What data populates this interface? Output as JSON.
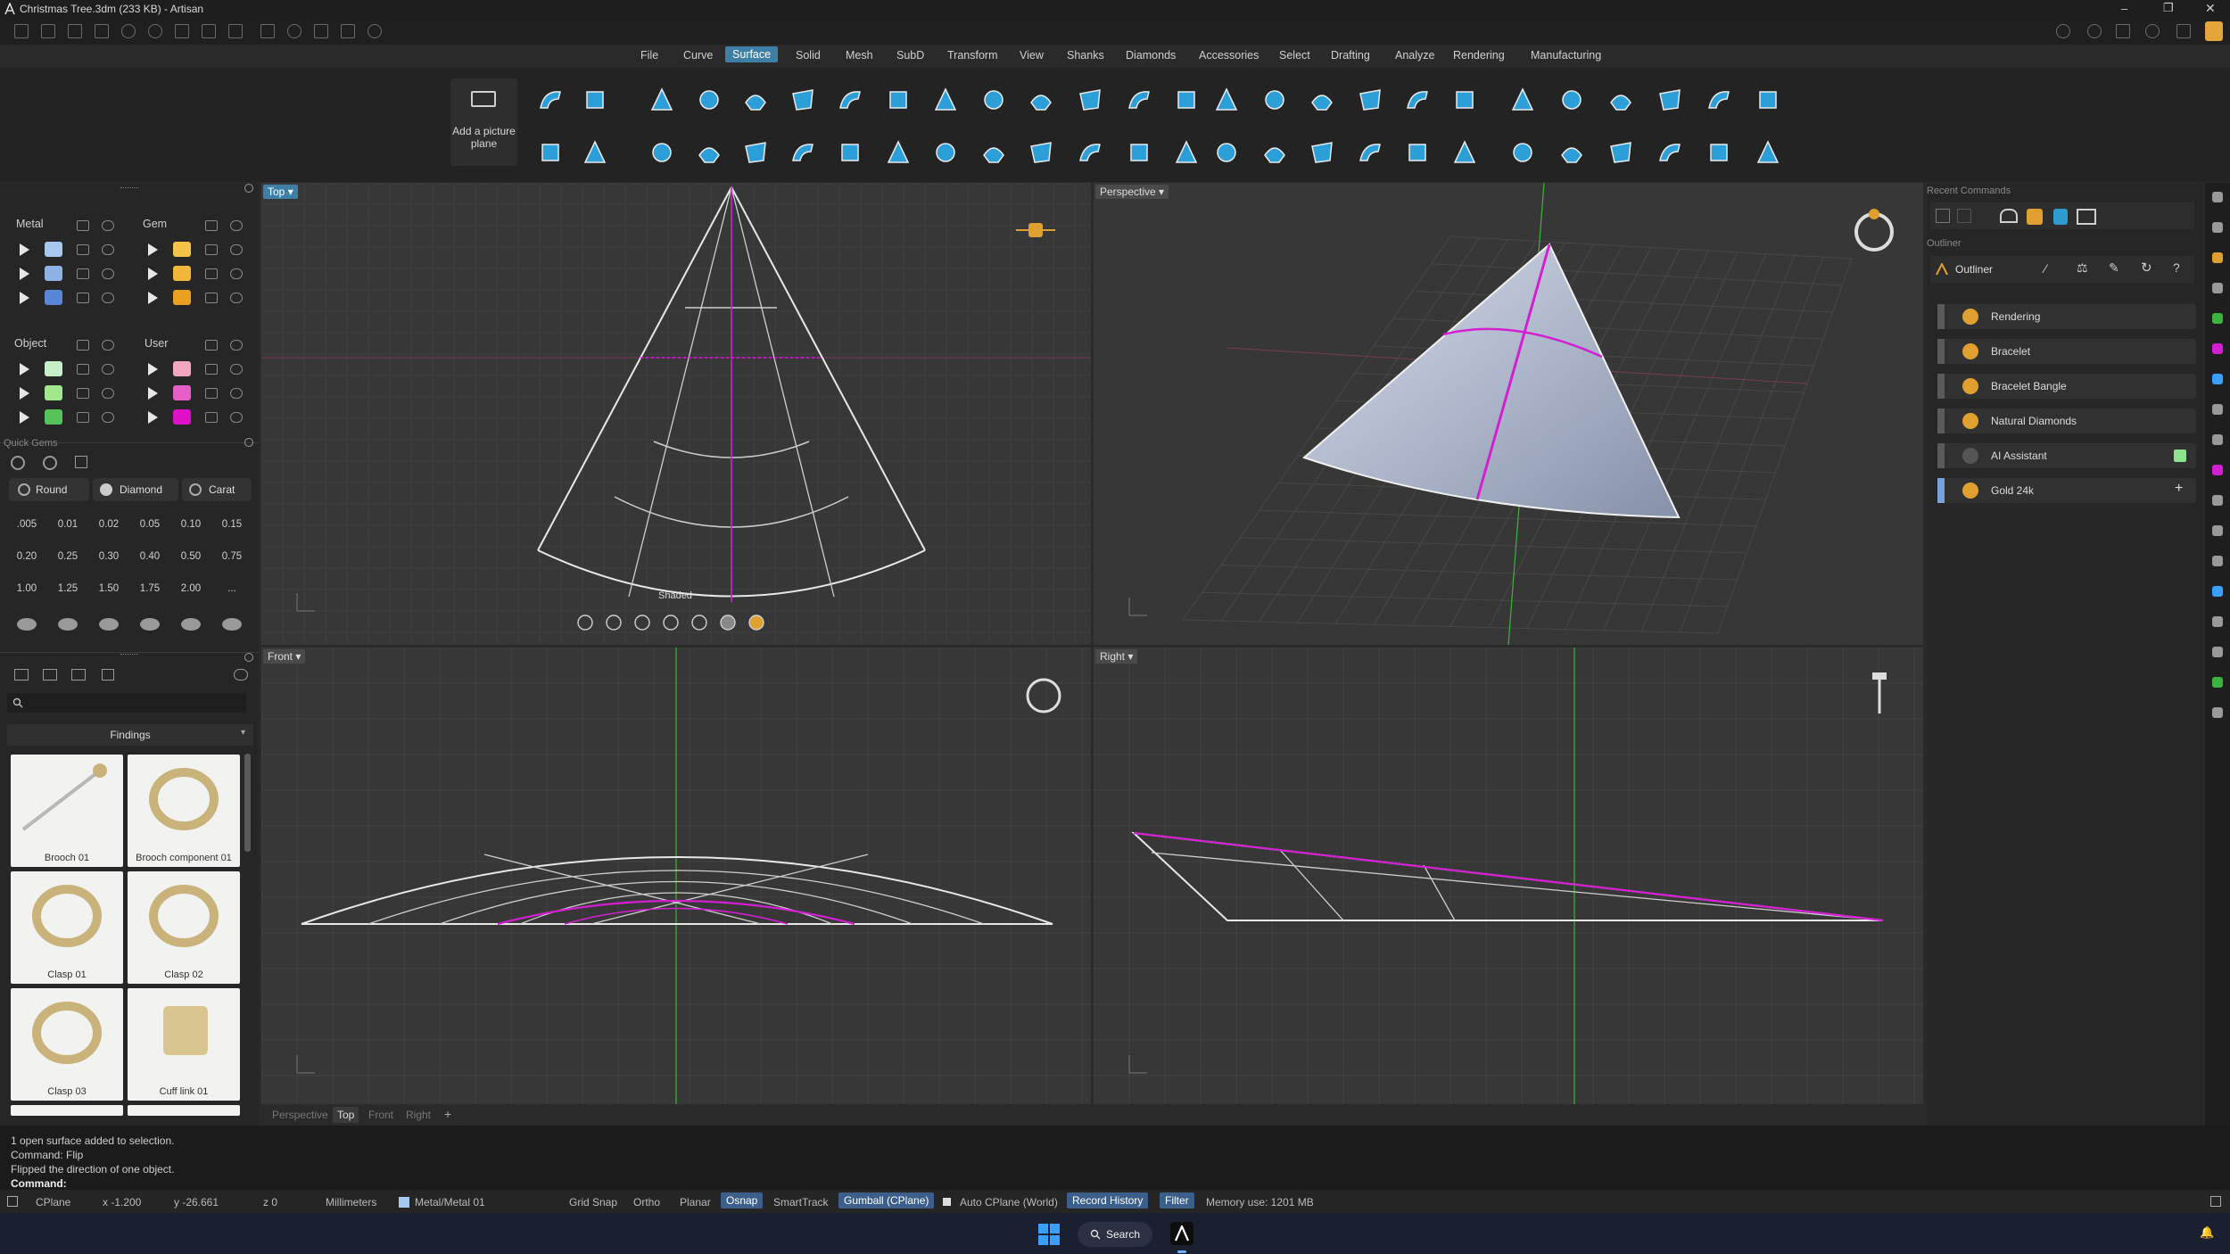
{
  "window": {
    "title": "Christmas Tree.3dm (233 KB) - Artisan"
  },
  "menu": {
    "items": [
      "File",
      "Curve",
      "Surface",
      "Solid",
      "Mesh",
      "SubD",
      "Transform",
      "View",
      "Shanks",
      "Diamonds",
      "Accessories",
      "Select",
      "Drafting",
      "Analyze",
      "Rendering",
      "Manufacturing"
    ],
    "active": "Surface"
  },
  "ribbon": {
    "picture_plane_label": "Add a picture plane"
  },
  "layers": {
    "metal": "Metal",
    "gem": "Gem",
    "object": "Object",
    "user": "User",
    "metal_colors": [
      "#a9c8f0",
      "#8fb2e6",
      "#5a86d6"
    ],
    "gem_colors": [
      "#f4c34a",
      "#f2b73a",
      "#eaa020"
    ],
    "object_colors": [
      "#c8f0c8",
      "#a2e68e",
      "#56c25a"
    ],
    "user_colors": [
      "#f3a6bf",
      "#e65fc8",
      "#e010c8"
    ]
  },
  "quick_gems": {
    "title": "Quick Gems",
    "shape": "Round",
    "cut": "Diamond",
    "unit": "Carat",
    "sizes": [
      ".005",
      "0.01",
      "0.02",
      "0.05",
      "0.10",
      "0.15",
      "0.20",
      "0.25",
      "0.30",
      "0.40",
      "0.50",
      "0.75",
      "1.00",
      "1.25",
      "1.50",
      "1.75",
      "2.00",
      "..."
    ]
  },
  "library": {
    "category": "Findings",
    "items": [
      "Brooch 01",
      "Brooch component 01",
      "Clasp 01",
      "Clasp 02",
      "Clasp 03",
      "Cuff link 01"
    ]
  },
  "viewports": {
    "top": "Top",
    "perspective": "Perspective",
    "front": "Front",
    "right": "Right",
    "shaded_label": "Shaded"
  },
  "viewport_tabs": [
    "Perspective",
    "Top",
    "Front",
    "Right",
    "+"
  ],
  "viewport_tab_active": "Top",
  "right_panel": {
    "recent_commands": "Recent Commands",
    "outliner_section": "Outliner",
    "outliner_title": "Outliner",
    "items": [
      "Rendering",
      "Bracelet",
      "Bracelet Bangle",
      "Natural Diamonds",
      "AI Assistant",
      "Gold 24k"
    ]
  },
  "command": {
    "history": [
      "1 open surface added to selection.",
      "Command: Flip",
      "Flipped the direction of one object."
    ],
    "prompt": "Command:"
  },
  "status": {
    "cplane": "CPlane",
    "x": "x -1.200",
    "y": "y -26.661",
    "z": "z 0",
    "units": "Millimeters",
    "layer": "Metal/Metal 01",
    "grid_snap": "Grid Snap",
    "ortho": "Ortho",
    "planar": "Planar",
    "osnap": "Osnap",
    "smarttrack": "SmartTrack",
    "gumball": "Gumball (CPlane)",
    "auto_cplane": "Auto CPlane (World)",
    "record_history": "Record History",
    "filter": "Filter",
    "memory": "Memory use: 1201 MB"
  },
  "taskbar": {
    "search": "Search"
  },
  "colors": {
    "accent": "#3e7fa8",
    "magenta": "#d21fd2",
    "green_axis": "#3db33d",
    "viewport_bg": "#373737"
  }
}
